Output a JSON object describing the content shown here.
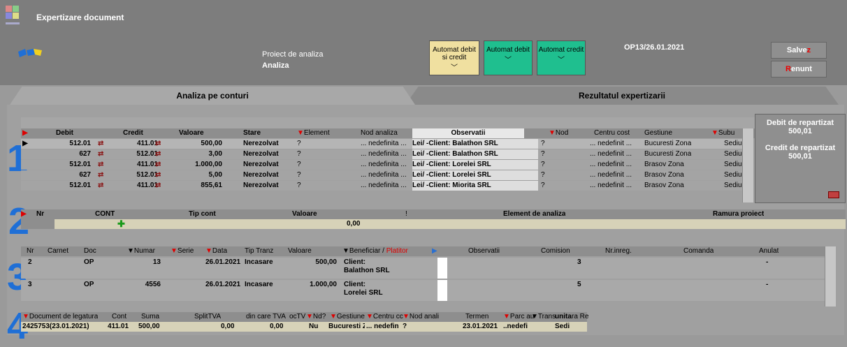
{
  "window": {
    "title": "Expertizare document"
  },
  "project": {
    "label": "Proiect de analiza",
    "value": "Analiza"
  },
  "auto_buttons": [
    {
      "label": "Automat debit si credit",
      "color": "#f0e0a0"
    },
    {
      "label": "Automat debit",
      "color": "#1fbf8f"
    },
    {
      "label": "Automat credit",
      "color": "#1fbf8f"
    }
  ],
  "op_ref": "OP13/26.01.2021",
  "actions": {
    "save": "Salve",
    "save_hot": "z",
    "cancel_hot": "R",
    "cancel": "enunt"
  },
  "tabs": [
    "Analiza pe conturi",
    "Rezultatul expertizarii"
  ],
  "section_numbers": [
    "1",
    "2",
    "3",
    "4"
  ],
  "grid1": {
    "headers": [
      "Debit",
      "Credit",
      "Valoare",
      "Stare",
      "Element",
      "Nod analiza",
      "Observatii",
      "Nod",
      "Centru cost",
      "Gestiune",
      "Subu"
    ],
    "rows": [
      {
        "debit": "512.01",
        "credit": "411.01",
        "valoare": "500,00",
        "stare": "Nerezolvat",
        "element": "?",
        "nod_analiza": "... nedefinita ...",
        "obs": "Lei/ -Client: Balathon SRL",
        "nod": "?",
        "centru": "... nedefinit ...",
        "gestiune": "Bucuresti Zona",
        "subu": "Sediu c"
      },
      {
        "debit": "627",
        "credit": "512.01",
        "valoare": "3,00",
        "stare": "Nerezolvat",
        "element": "?",
        "nod_analiza": "... nedefinita ...",
        "obs": "Lei/ -Client: Balathon SRL",
        "nod": "?",
        "centru": "... nedefinit ...",
        "gestiune": "Bucuresti Zona",
        "subu": "Sediu c"
      },
      {
        "debit": "512.01",
        "credit": "411.01",
        "valoare": "1.000,00",
        "stare": "Nerezolvat",
        "element": "?",
        "nod_analiza": "... nedefinita ...",
        "obs": "Lei/ -Client: Lorelei SRL",
        "nod": "?",
        "centru": "... nedefinit ...",
        "gestiune": "Brasov Zona",
        "subu": "Sediu c"
      },
      {
        "debit": "627",
        "credit": "512.01",
        "valoare": "5,00",
        "stare": "Nerezolvat",
        "element": "?",
        "nod_analiza": "... nedefinita ...",
        "obs": "Lei/ -Client: Lorelei SRL",
        "nod": "?",
        "centru": "... nedefinit ...",
        "gestiune": "Brasov Zona",
        "subu": "Sediu c"
      },
      {
        "debit": "512.01",
        "credit": "411.01",
        "valoare": "855,61",
        "stare": "Nerezolvat",
        "element": "?",
        "nod_analiza": "... nedefinita ...",
        "obs": "Lei/ -Client: Miorita SRL",
        "nod": "?",
        "centru": "... nedefinit ...",
        "gestiune": "Brasov Zona",
        "subu": "Sediu c"
      }
    ]
  },
  "repartizat": {
    "debit_label": "Debit de repartizat",
    "debit_value": "500,01",
    "credit_label": "Credit de repartizat",
    "credit_value": "500,01"
  },
  "grid2": {
    "headers": [
      "Nr",
      "CONT",
      "Tip cont",
      "Valoare",
      "!",
      "Element de analiza",
      "Ramura proiect"
    ],
    "row": {
      "valoare": "0,00"
    }
  },
  "grid3": {
    "headers": [
      "Nr",
      "Carnet",
      "Doc",
      "Numar",
      "Serie",
      "Data",
      "Tip Tranz",
      "Valoare",
      "Beneficiar /",
      "Platitor",
      "Observatii",
      "Comision",
      "Nr.inreg.",
      "Comanda",
      "Anulat"
    ],
    "rows": [
      {
        "nr": "2",
        "doc": "OP",
        "numar": "13",
        "data": "26.01.2021",
        "tip": "Incasare",
        "valoare": "500,00",
        "benef": "Client:",
        "benef2": "Balathon SRL",
        "comision": "3",
        "anulat": "-"
      },
      {
        "nr": "3",
        "doc": "OP",
        "numar": "4556",
        "data": "26.01.2021",
        "tip": "Incasare",
        "valoare": "1.000,00",
        "benef": "Client:",
        "benef2": "Lorelei SRL",
        "comision": "5",
        "anulat": "-"
      }
    ]
  },
  "grid4": {
    "headers": [
      "Document de legatura",
      "Cont",
      "Suma",
      "SplitTVA",
      "din care TVA",
      "ocTV",
      "Nd?",
      "Gestiune",
      "Centru cc",
      "Nod anali",
      "Termen",
      "Parc au",
      "Trans",
      "unita",
      "ra Re"
    ],
    "row": {
      "doc": "2425753(23.01.2021)",
      "cont": "411.01",
      "suma": "500,00",
      "split": "0,00",
      "tva": "0,00",
      "nd": "Nu",
      "gest": "Bucuresti Z",
      "centru": "... nedefin",
      "nod": "?",
      "termen": "23.01.2021",
      "parc": "..nedefi",
      "unita": "Sedi"
    }
  }
}
